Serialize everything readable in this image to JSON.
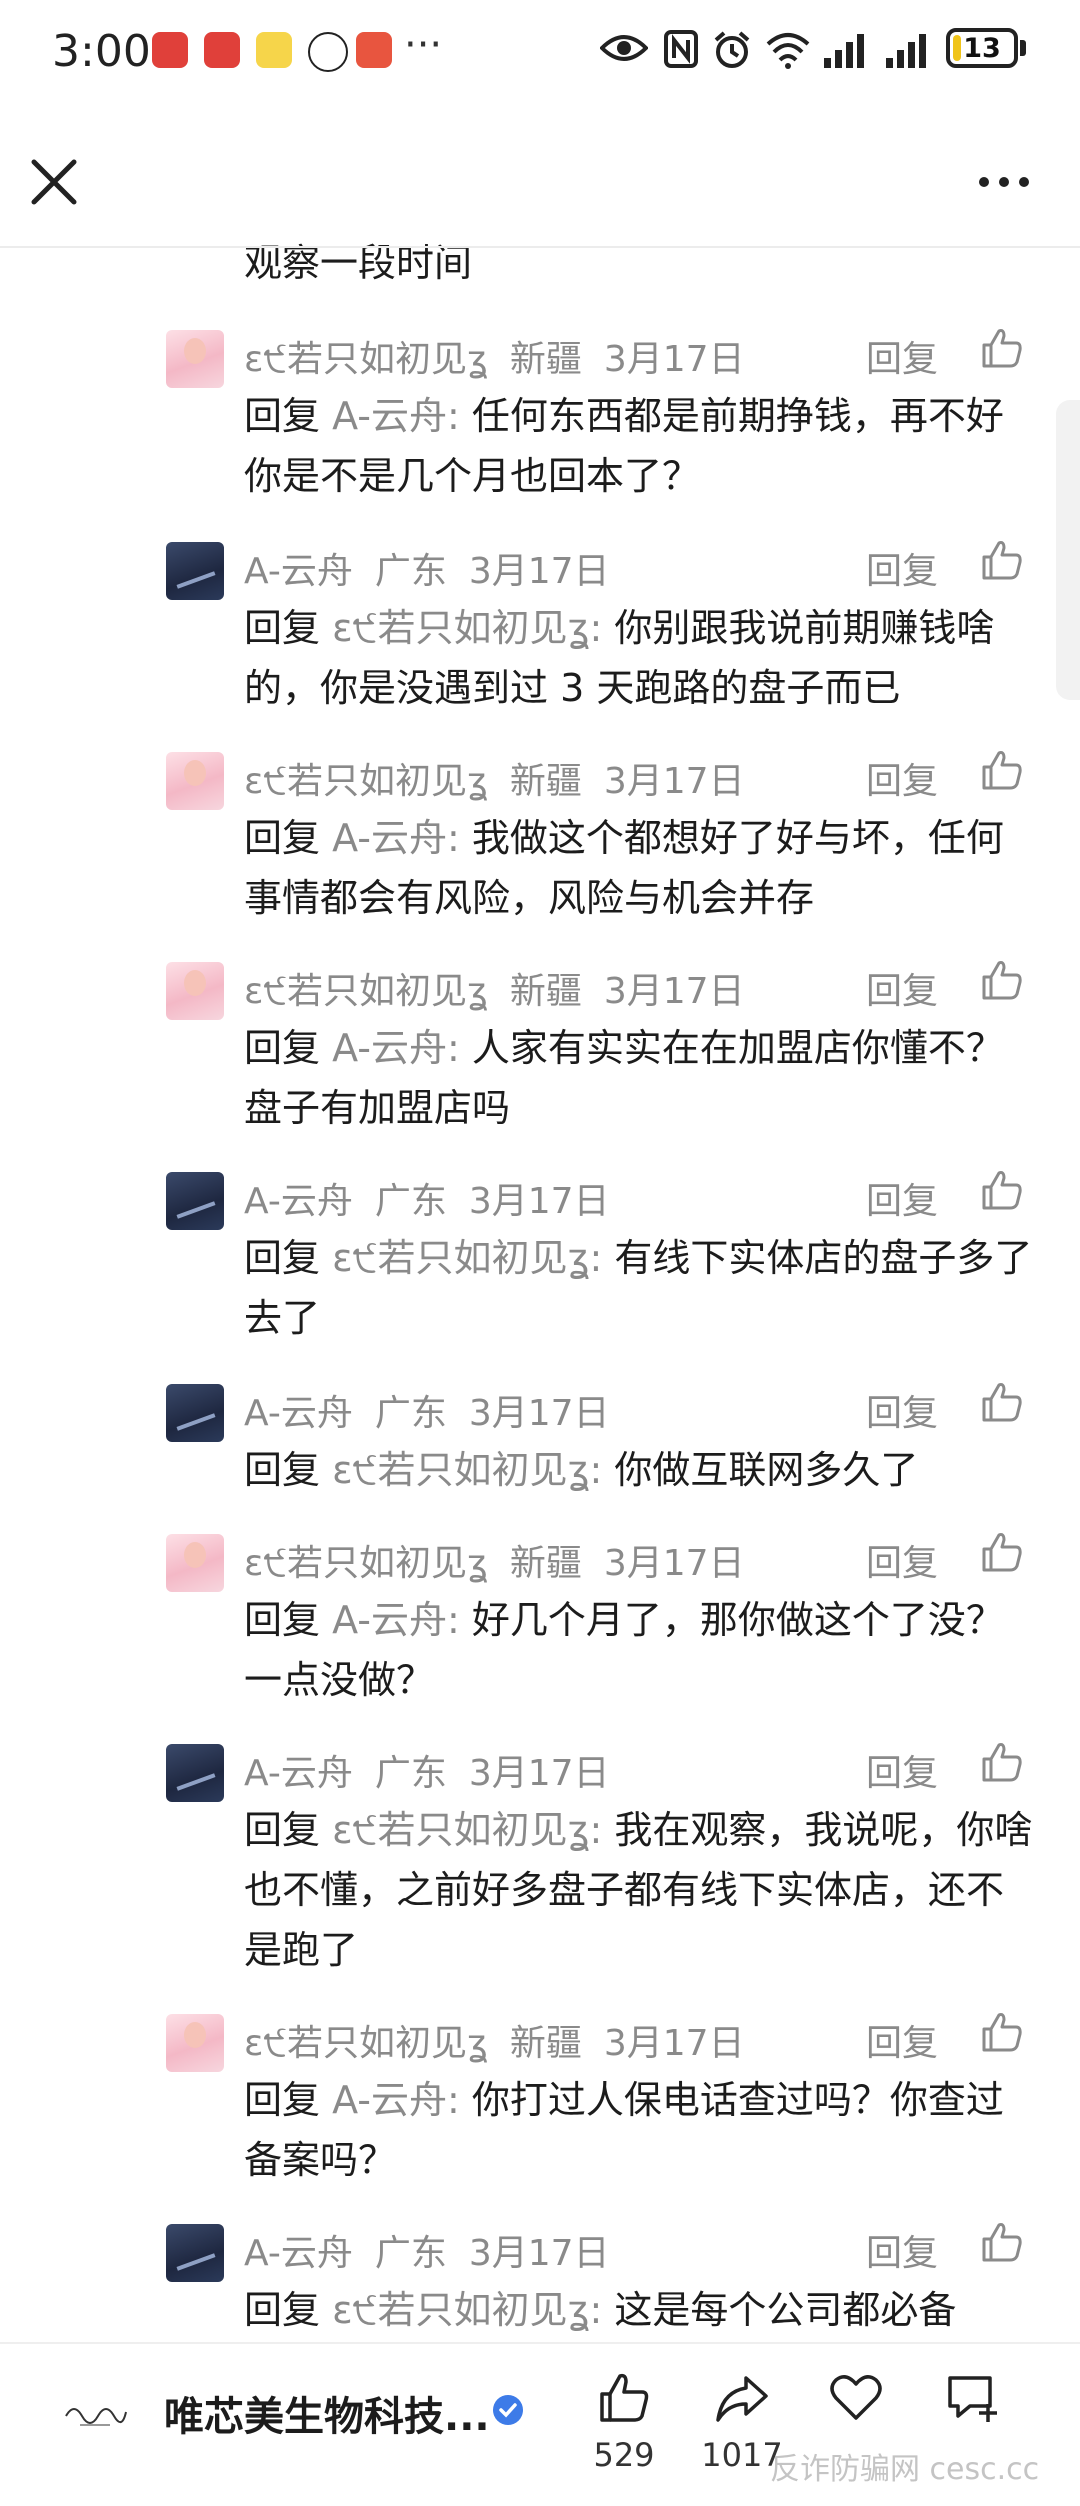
{
  "status_bar": {
    "time": "3:00",
    "more": "···",
    "battery": "13",
    "icons": [
      "eye-icon",
      "nfc-icon",
      "alarm-icon",
      "wifi-icon",
      "signal-icon",
      "signal-icon"
    ]
  },
  "nav": {
    "close_icon": "close-icon",
    "more_icon": "more-horizontal-icon"
  },
  "partial_text": "观察一段时间",
  "comments": [
    {
      "author": "ε੯若只如初见ʓ",
      "location": "新疆",
      "date": "3月17日",
      "reply_label": "回复",
      "reply_prefix": "回复",
      "reply_to": "A-云舟:",
      "text": "任何东西都是前期挣钱，再不好你是不是几个月也回本了？",
      "avatar": "pink"
    },
    {
      "author": "A-云舟",
      "location": "广东",
      "date": "3月17日",
      "reply_label": "回复",
      "reply_prefix": "回复",
      "reply_to": "ε੯若只如初见ʓ:",
      "text": "你别跟我说前期赚钱啥的，你是没遇到过 3 天跑路的盘子而已",
      "avatar": "dark"
    },
    {
      "author": "ε੯若只如初见ʓ",
      "location": "新疆",
      "date": "3月17日",
      "reply_label": "回复",
      "reply_prefix": "回复",
      "reply_to": "A-云舟:",
      "text": "我做这个都想好了好与坏，任何事情都会有风险，风险与机会并存",
      "avatar": "pink"
    },
    {
      "author": "ε੯若只如初见ʓ",
      "location": "新疆",
      "date": "3月17日",
      "reply_label": "回复",
      "reply_prefix": "回复",
      "reply_to": "A-云舟:",
      "text": "人家有实实在在加盟店你懂不？盘子有加盟店吗",
      "avatar": "pink"
    },
    {
      "author": "A-云舟",
      "location": "广东",
      "date": "3月17日",
      "reply_label": "回复",
      "reply_prefix": "回复",
      "reply_to": "ε੯若只如初见ʓ:",
      "text": "有线下实体店的盘子多了去了",
      "avatar": "dark"
    },
    {
      "author": "A-云舟",
      "location": "广东",
      "date": "3月17日",
      "reply_label": "回复",
      "reply_prefix": "回复",
      "reply_to": "ε੯若只如初见ʓ:",
      "text": "你做互联网多久了",
      "avatar": "dark"
    },
    {
      "author": "ε੯若只如初见ʓ",
      "location": "新疆",
      "date": "3月17日",
      "reply_label": "回复",
      "reply_prefix": "回复",
      "reply_to": "A-云舟:",
      "text": "好几个月了，那你做这个了没？一点没做？",
      "avatar": "pink"
    },
    {
      "author": "A-云舟",
      "location": "广东",
      "date": "3月17日",
      "reply_label": "回复",
      "reply_prefix": "回复",
      "reply_to": "ε੯若只如初见ʓ:",
      "text": "我在观察，我说呢，你啥也不懂，之前好多盘子都有线下实体店，还不是跑了",
      "avatar": "dark"
    },
    {
      "author": "ε੯若只如初见ʓ",
      "location": "新疆",
      "date": "3月17日",
      "reply_label": "回复",
      "reply_prefix": "回复",
      "reply_to": "A-云舟:",
      "text": "你打过人保电话查过吗？你查过备案吗？",
      "avatar": "pink"
    },
    {
      "author": "A-云舟",
      "location": "广东",
      "date": "3月17日",
      "reply_label": "回复",
      "reply_prefix": "回复",
      "reply_to": "ε੯若只如初见ʓ:",
      "text": "这是每个公司都必备",
      "avatar": "dark"
    }
  ],
  "bottom_bar": {
    "brand_name": "唯芯美生物科技...",
    "like_count": "529",
    "share_count": "1017",
    "watermark": "反诈防骗网 cesc.cc"
  },
  "colors": {
    "text_primary": "#1c1c1c",
    "text_secondary": "#8a8a8a",
    "verified_blue": "#3d7be8",
    "battery_yellow": "#f0c419"
  }
}
